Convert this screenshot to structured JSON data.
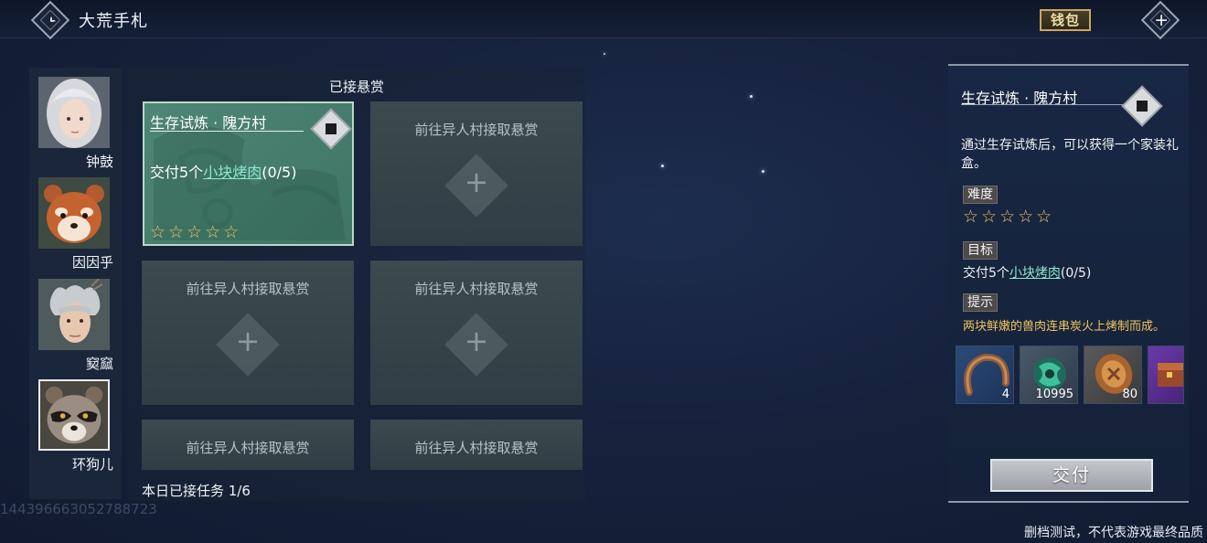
{
  "header": {
    "title": "大荒手札",
    "wallet_label": "钱包",
    "back_icon": "chevron-left-icon",
    "close_icon": "close-icon"
  },
  "characters": [
    {
      "name": "钟鼓",
      "icon": "portrait-silver-haired-girl",
      "selected": false
    },
    {
      "name": "因因乎",
      "icon": "portrait-red-panda",
      "selected": false
    },
    {
      "name": "窫窳",
      "icon": "portrait-horned-man",
      "selected": false
    },
    {
      "name": "环狗儿",
      "icon": "portrait-raccoon",
      "selected": true
    }
  ],
  "board": {
    "title": "已接悬赏",
    "accepted_quest": {
      "title": "生存试炼 · 隗方村",
      "task_prefix": "交付5个",
      "task_item": "小块烤肉",
      "task_progress": "(0/5)",
      "stars": "☆☆☆☆☆",
      "difficulty": 5
    },
    "empty_slot_label": "前往异人村接取悬赏",
    "empty_slots": [
      {
        "label": "前往异人村接取悬赏"
      },
      {
        "label": "前往异人村接取悬赏"
      },
      {
        "label": "前往异人村接取悬赏"
      },
      {
        "label": "前往异人村接取悬赏"
      },
      {
        "label": "前往异人村接取悬赏"
      }
    ],
    "daily_count": "本日已接任务 1/6"
  },
  "uid": "144396663052788723",
  "detail": {
    "title": "生存试炼 · 隗方村",
    "description": "通过生存试炼后，可以获得一个家装礼盒。",
    "difficulty_label": "难度",
    "stars": "☆☆☆☆☆",
    "difficulty": 5,
    "target_label": "目标",
    "target_prefix": "交付5个",
    "target_item": "小块烤肉",
    "target_progress": "(0/5)",
    "hint_label": "提示",
    "hint_text": "两块鲜嫩的兽肉连串炭火上烤制而成。",
    "rewards": [
      {
        "icon": "horseshoe-icon",
        "qty": "4"
      },
      {
        "icon": "jade-orb-icon",
        "qty": "10995"
      },
      {
        "icon": "bronze-coin-icon",
        "qty": "80"
      },
      {
        "icon": "treasure-chest-icon",
        "qty": ""
      }
    ],
    "submit_label": "交付"
  },
  "footer": {
    "disclaimer": "删档测试，不代表游戏最终品质"
  },
  "colors": {
    "background": "#16223d",
    "accent_gold": "#f2c65a",
    "link_teal": "#8fe6cf",
    "quest_card": "#4e8676"
  }
}
